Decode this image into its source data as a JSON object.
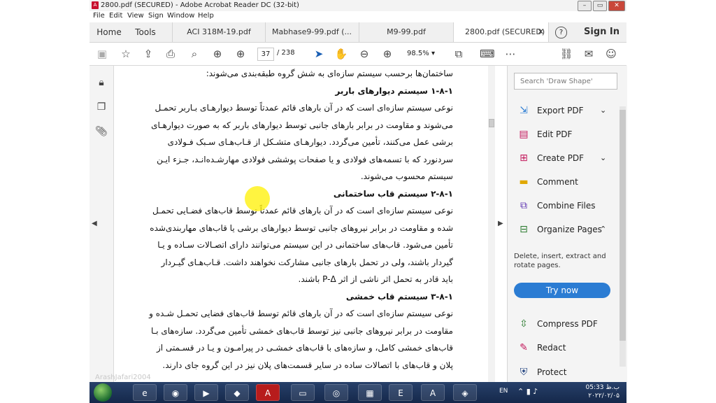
{
  "window": {
    "title": "2800.pdf (SECURED) - Adobe Acrobat Reader DC (32-bit)"
  },
  "menu": [
    "File",
    "Edit",
    "View",
    "Sign",
    "Window",
    "Help"
  ],
  "tabs": {
    "home": "Home",
    "tools": "Tools",
    "docs": [
      "ACI 318M-19.pdf",
      "Mabhase9-99.pdf (...",
      "M9-99.pdf",
      "2800.pdf (SECURED)"
    ],
    "help": "?",
    "signin": "Sign In"
  },
  "toolbar": {
    "page_current": "37",
    "page_total": "/ 238",
    "zoom": "98.5%"
  },
  "document": {
    "lines": [
      {
        "text": "ساختمان‌ها برحسب سیستم سازه‌ای به شش گروه طبقه‌بندی می‌شوند:",
        "heading": false
      },
      {
        "text": "۱-۸-۱  سیستم دیوارهای باربر",
        "heading": true
      },
      {
        "text": "نوعی سیستم سازه‌ای است که در آن بارهای قائم عمدتاً توسط دیوارهـای بـاربر تحمـل",
        "heading": false
      },
      {
        "text": "می‌شوند و مقاومت در برابر بارهای جانبی توسط دیوارهای باربر که به صورت دیوارهـای",
        "heading": false
      },
      {
        "text": "برشی عمل می‌کنند، تأمین می‌گردد. دیوارهـای متشـکل از قـاب‌هـای سـبک فـولادی",
        "heading": false
      },
      {
        "text": "سردنورد که با تسمه‌های فولادی و یا صفحات پوششی فولادی مهارشـده‌انـد، جـزء ایـن",
        "heading": false
      },
      {
        "text": "سیستم محسوب می‌شوند.",
        "heading": false
      },
      {
        "text": "۲-۸-۱  سیستم قاب ساختمانی",
        "heading": true
      },
      {
        "text": "نوعی سیستم سازه‌ای است که در آن بارهای قائم عمدتاً توسط قاب‌های فضـایی تحمـل",
        "heading": false
      },
      {
        "text": "شده و مقاومت در برابر نیروهای جانبی توسط دیوارهای برشی یا قاب‌های مهاربندی‌شده",
        "heading": false
      },
      {
        "text": "تأمین می‌شود. قاب‌های ساختمانی در این سیستم می‌توانند دارای اتصـالات سـاده و یـا",
        "heading": false
      },
      {
        "text": "گیردار باشند، ولی در تحمل بارهای جانبی مشارکت نخواهند داشت. قـاب‌هـای گیـردار",
        "heading": false
      },
      {
        "text": "باید قادر به تحمل اثر ناشی از اثر P-Δ باشند.",
        "heading": false
      },
      {
        "text": "۳-۸-۱  سیستم قاب خمشی",
        "heading": true
      },
      {
        "text": "نوعی سیستم سازه‌ای است که در آن بارهای قائم توسط قاب‌های فضایی تحمـل شـده و",
        "heading": false
      },
      {
        "text": "مقاومت در برابر نیروهای جانبی نیز توسط قاب‌های خمشی تأمین می‌گردد. سازه‌های بـا",
        "heading": false
      },
      {
        "text": "قاب‌های خمشی کامل، و سازه‌های با قاب‌های خمشـی در پیرامـون و یـا در قسـمتی از",
        "heading": false
      },
      {
        "text": "پلان و قاب‌های با اتصالات ساده در سایر قسمت‌های پلان نیز در این گروه جای دارند.",
        "heading": false
      }
    ]
  },
  "right_panel": {
    "search_placeholder": "Search 'Draw Shape'",
    "tools": [
      "Export PDF",
      "Edit PDF",
      "Create PDF",
      "Comment",
      "Combine Files",
      "Organize Pages",
      "Compress PDF",
      "Redact",
      "Protect"
    ],
    "organize_desc": "Delete, insert, extract and rotate pages.",
    "try_now": "Try now"
  },
  "taskbar": {
    "lang": "EN",
    "time": "05:33 ب.ظ",
    "date": "۲۰۲۲/۰۲/۰۵"
  },
  "watermark": "ArashJafari2004",
  "colors": {
    "accent": "#2b7cd3",
    "taskbar": "#1d3359",
    "cursor_highlight": "#fff000"
  }
}
